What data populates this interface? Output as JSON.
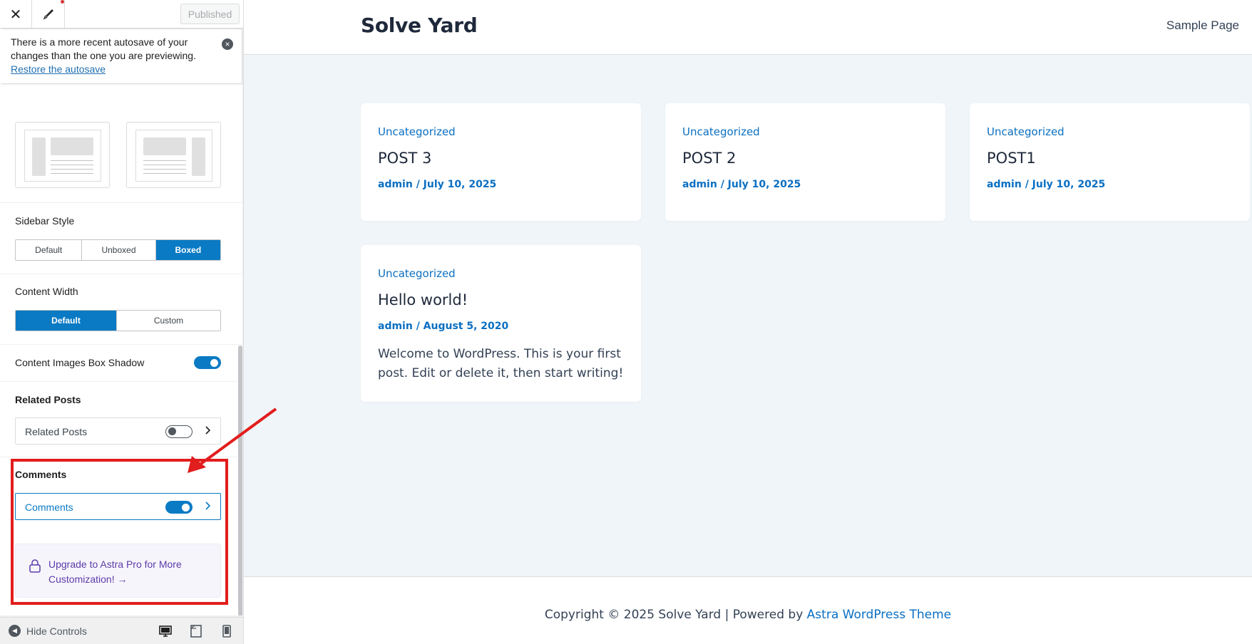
{
  "customizer": {
    "published_label": "Published",
    "autosave": {
      "message": "There is a more recent autosave of your changes than the one you are previewing.",
      "restore_link": "Restore the autosave"
    },
    "sidebar_style": {
      "label": "Sidebar Style",
      "options": [
        "Default",
        "Unboxed",
        "Boxed"
      ],
      "selected": "Boxed"
    },
    "content_width": {
      "label": "Content Width",
      "options": [
        "Default",
        "Custom"
      ],
      "selected": "Default"
    },
    "content_images_box_shadow": {
      "label": "Content Images Box Shadow",
      "enabled": true
    },
    "related_posts": {
      "title": "Related Posts",
      "row_label": "Related Posts",
      "enabled": false
    },
    "comments": {
      "title": "Comments",
      "row_label": "Comments",
      "enabled": true
    },
    "upgrade": {
      "text": "Upgrade to Astra Pro for More Customization! →"
    },
    "footer": {
      "hide_controls": "Hide Controls"
    },
    "icons": [
      "close-icon",
      "brush-icon",
      "lock-icon",
      "chevron-right-icon",
      "desktop-icon",
      "tablet-icon",
      "mobile-icon",
      "arrow-left-circle-icon"
    ],
    "colors": {
      "accent": "#0a7ac4",
      "annotation_red": "#e21d1d",
      "pro_purple": "#5b3ba8"
    }
  },
  "site": {
    "title": "Solve Yard",
    "nav": {
      "sample_page": "Sample Page"
    },
    "posts": [
      {
        "category": "Uncategorized",
        "title": "POST 3",
        "meta": "admin / July 10, 2025",
        "excerpt": ""
      },
      {
        "category": "Uncategorized",
        "title": "POST 2",
        "meta": "admin / July 10, 2025",
        "excerpt": ""
      },
      {
        "category": "Uncategorized",
        "title": "POST1",
        "meta": "admin / July 10, 2025",
        "excerpt": ""
      },
      {
        "category": "Uncategorized",
        "title": "Hello world!",
        "meta": "admin / August 5, 2020",
        "excerpt": "Welcome to WordPress. This is your first post. Edit or delete it, then start writing!"
      }
    ],
    "footer": {
      "copyright": "Copyright © 2025 Solve Yard | Powered by ",
      "theme_link": "Astra WordPress Theme"
    },
    "colors": {
      "link": "#0a6fc2",
      "background": "#f0f5fa"
    }
  }
}
